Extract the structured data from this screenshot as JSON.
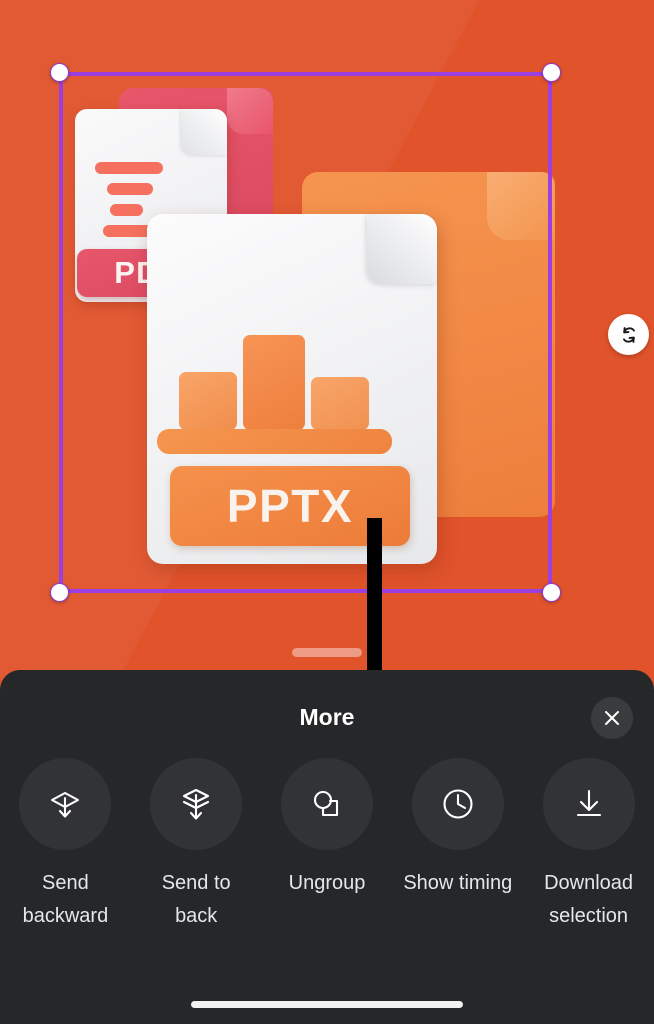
{
  "canvas": {
    "background_color": "#E0532B",
    "selection": {
      "border_color": "#9B3FE0",
      "handle_color": "#FFFFFF",
      "handle_names": [
        "top-left",
        "top-right",
        "bottom-left",
        "bottom-right"
      ]
    },
    "rotate_button": {
      "icon": "rotate-icon"
    },
    "artwork": {
      "pdf_label": "PDF",
      "pptx_label": "PPTX"
    },
    "annotation": {
      "icon": "down-arrow-annotation",
      "color": "#000000"
    }
  },
  "sheet": {
    "title": "More",
    "close": {
      "icon": "close-icon",
      "label": "Close"
    },
    "background_color": "#262729",
    "actions": [
      {
        "id": "send-backward",
        "icon": "send-backward-icon",
        "label": "Send\nbackward"
      },
      {
        "id": "send-to-back",
        "icon": "send-to-back-icon",
        "label": "Send to\nback"
      },
      {
        "id": "ungroup",
        "icon": "ungroup-icon",
        "label": "Ungroup"
      },
      {
        "id": "show-timing",
        "icon": "clock-icon",
        "label": "Show timing"
      },
      {
        "id": "download-selection",
        "icon": "download-icon",
        "label": "Download\nselection"
      }
    ]
  },
  "system": {
    "home_indicator": ""
  }
}
